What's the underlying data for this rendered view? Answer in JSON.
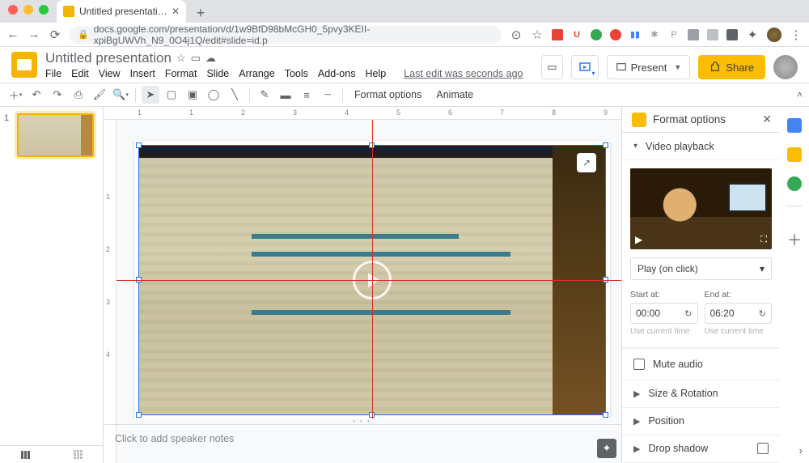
{
  "browser": {
    "tab_title": "Untitled presentation – Google",
    "url": "docs.google.com/presentation/d/1w9BfD98bMcGH0_5pvy3KEII-xpiBgUWVh_N9_0O4j1Q/edit#slide=id.p"
  },
  "doc": {
    "title": "Untitled presentation",
    "last_edit": "Last edit was seconds ago"
  },
  "menus": [
    "File",
    "Edit",
    "View",
    "Insert",
    "Format",
    "Slide",
    "Arrange",
    "Tools",
    "Add-ons",
    "Help"
  ],
  "titlebar_actions": {
    "present": "Present",
    "share": "Share"
  },
  "toolbar": {
    "format_options": "Format options",
    "animate": "Animate"
  },
  "ruler_h": [
    "1",
    "",
    "1",
    "",
    "2",
    "",
    "3",
    "",
    "4",
    "",
    "5",
    "",
    "6",
    "",
    "7",
    "",
    "8",
    "",
    "9",
    ""
  ],
  "ruler_v": [
    "1",
    "2",
    "3",
    "4"
  ],
  "slide_number": "1",
  "speaker_notes_placeholder": "Click to add speaker notes",
  "panel": {
    "title": "Format options",
    "section_playback": "Video playback",
    "play_mode": "Play (on click)",
    "start_at_label": "Start at:",
    "end_at_label": "End at:",
    "start_at": "00:00",
    "end_at": "06:20",
    "use_current": "Use current time",
    "mute": "Mute audio",
    "size_rotation": "Size & Rotation",
    "position": "Position",
    "drop_shadow": "Drop shadow"
  }
}
